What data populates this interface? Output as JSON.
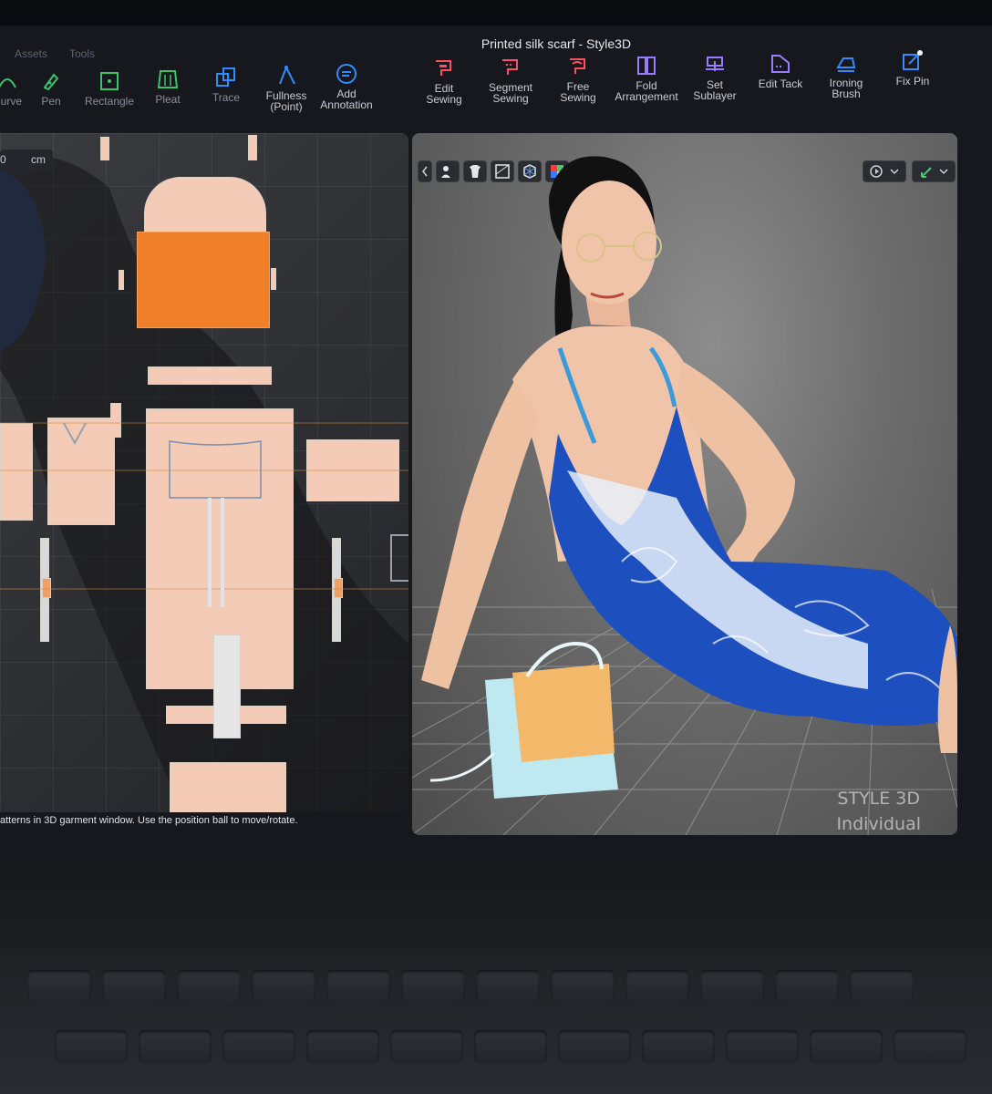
{
  "window": {
    "title": "Printed silk scarf - Style3D"
  },
  "menu": {
    "items": [
      "Assets",
      "Tools"
    ]
  },
  "toolbar": {
    "left_tools": [
      {
        "label": "Curve",
        "icon": "curve-icon"
      },
      {
        "label": "Pen",
        "icon": "pen-icon"
      },
      {
        "label": "Rectangle",
        "icon": "rectangle-icon"
      },
      {
        "label": "Pleat",
        "icon": "pleat-icon"
      },
      {
        "label": "Trace",
        "icon": "trace-icon"
      },
      {
        "label": "Fullness (Point)",
        "icon": "fullness-point-icon"
      },
      {
        "label": "Add Annotation",
        "icon": "add-annotation-icon"
      }
    ],
    "right_tools": [
      {
        "label": "Edit Sewing",
        "icon": "edit-sewing-icon"
      },
      {
        "label": "Segment Sewing",
        "icon": "segment-sewing-icon"
      },
      {
        "label": "Free Sewing",
        "icon": "free-sewing-icon"
      },
      {
        "label": "Fold Arrangement",
        "icon": "fold-arrangement-icon"
      },
      {
        "label": "Set Sublayer",
        "icon": "set-sublayer-icon"
      },
      {
        "label": "Edit Tack",
        "icon": "edit-tack-icon"
      },
      {
        "label": "Ironing Brush",
        "icon": "ironing-brush-icon"
      },
      {
        "label": "Fix Pin",
        "icon": "fix-pin-icon"
      }
    ]
  },
  "pattern_window": {
    "unit_value": "0",
    "unit_label": "cm"
  },
  "viewport3d": {
    "watermark_line1": "STYLE 3D",
    "watermark_line2": "Individual"
  },
  "status": {
    "text": "atterns in 3D garment window. Use the position ball to move/rotate."
  },
  "colors": {
    "accent_green": "#39c46b",
    "accent_blue": "#2f8cff",
    "accent_red": "#ff4d64",
    "accent_purple": "#9b7bff",
    "pattern_piece": "#f3cbb6",
    "selected_piece": "#f07f2a"
  }
}
